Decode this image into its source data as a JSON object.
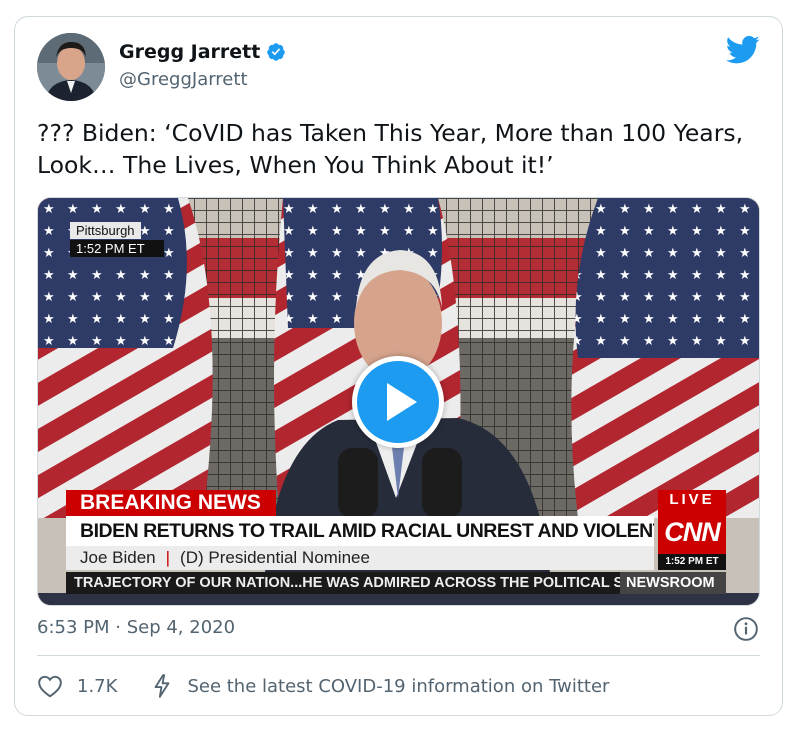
{
  "author": {
    "display_name": "Gregg Jarrett",
    "handle": "@GreggJarrett",
    "verified": true
  },
  "tweet": {
    "text": "??? Biden: ‘CoVID has Taken This Year, More than 100 Years, Look… The Lives, When You Think About it!’",
    "timestamp": "6:53 PM · Sep 4, 2020"
  },
  "video": {
    "location": "Pittsburgh",
    "location_time": "1:52 PM ET",
    "breaking_label": "BREAKING NEWS",
    "headline": "BIDEN RETURNS TO TRAIL AMID RACIAL UNREST AND VIOLENT PROTESTS",
    "speaker_name": "Joe Biden",
    "speaker_title": "(D) Presidential Nominee",
    "ticker": "TRAJECTORY OF OUR NATION...HE WAS ADMIRED ACROSS THE POLITICAL S",
    "ticker_section": "NEWSROOM",
    "live_label": "LIVE",
    "network_logo_text": "CNN",
    "network_time": "1:52 PM ET"
  },
  "actions": {
    "like_count": "1.7K",
    "covid_info": "See the latest COVID-19 information on Twitter"
  },
  "colors": {
    "twitter_blue": "#1d9bf0",
    "secondary_text": "#536471",
    "border": "#cfd9de",
    "cnn_red": "#cc0000"
  },
  "icons": [
    "verified-badge-icon",
    "twitter-bird-icon",
    "play-icon",
    "info-icon",
    "heart-icon",
    "covid-info-icon"
  ]
}
